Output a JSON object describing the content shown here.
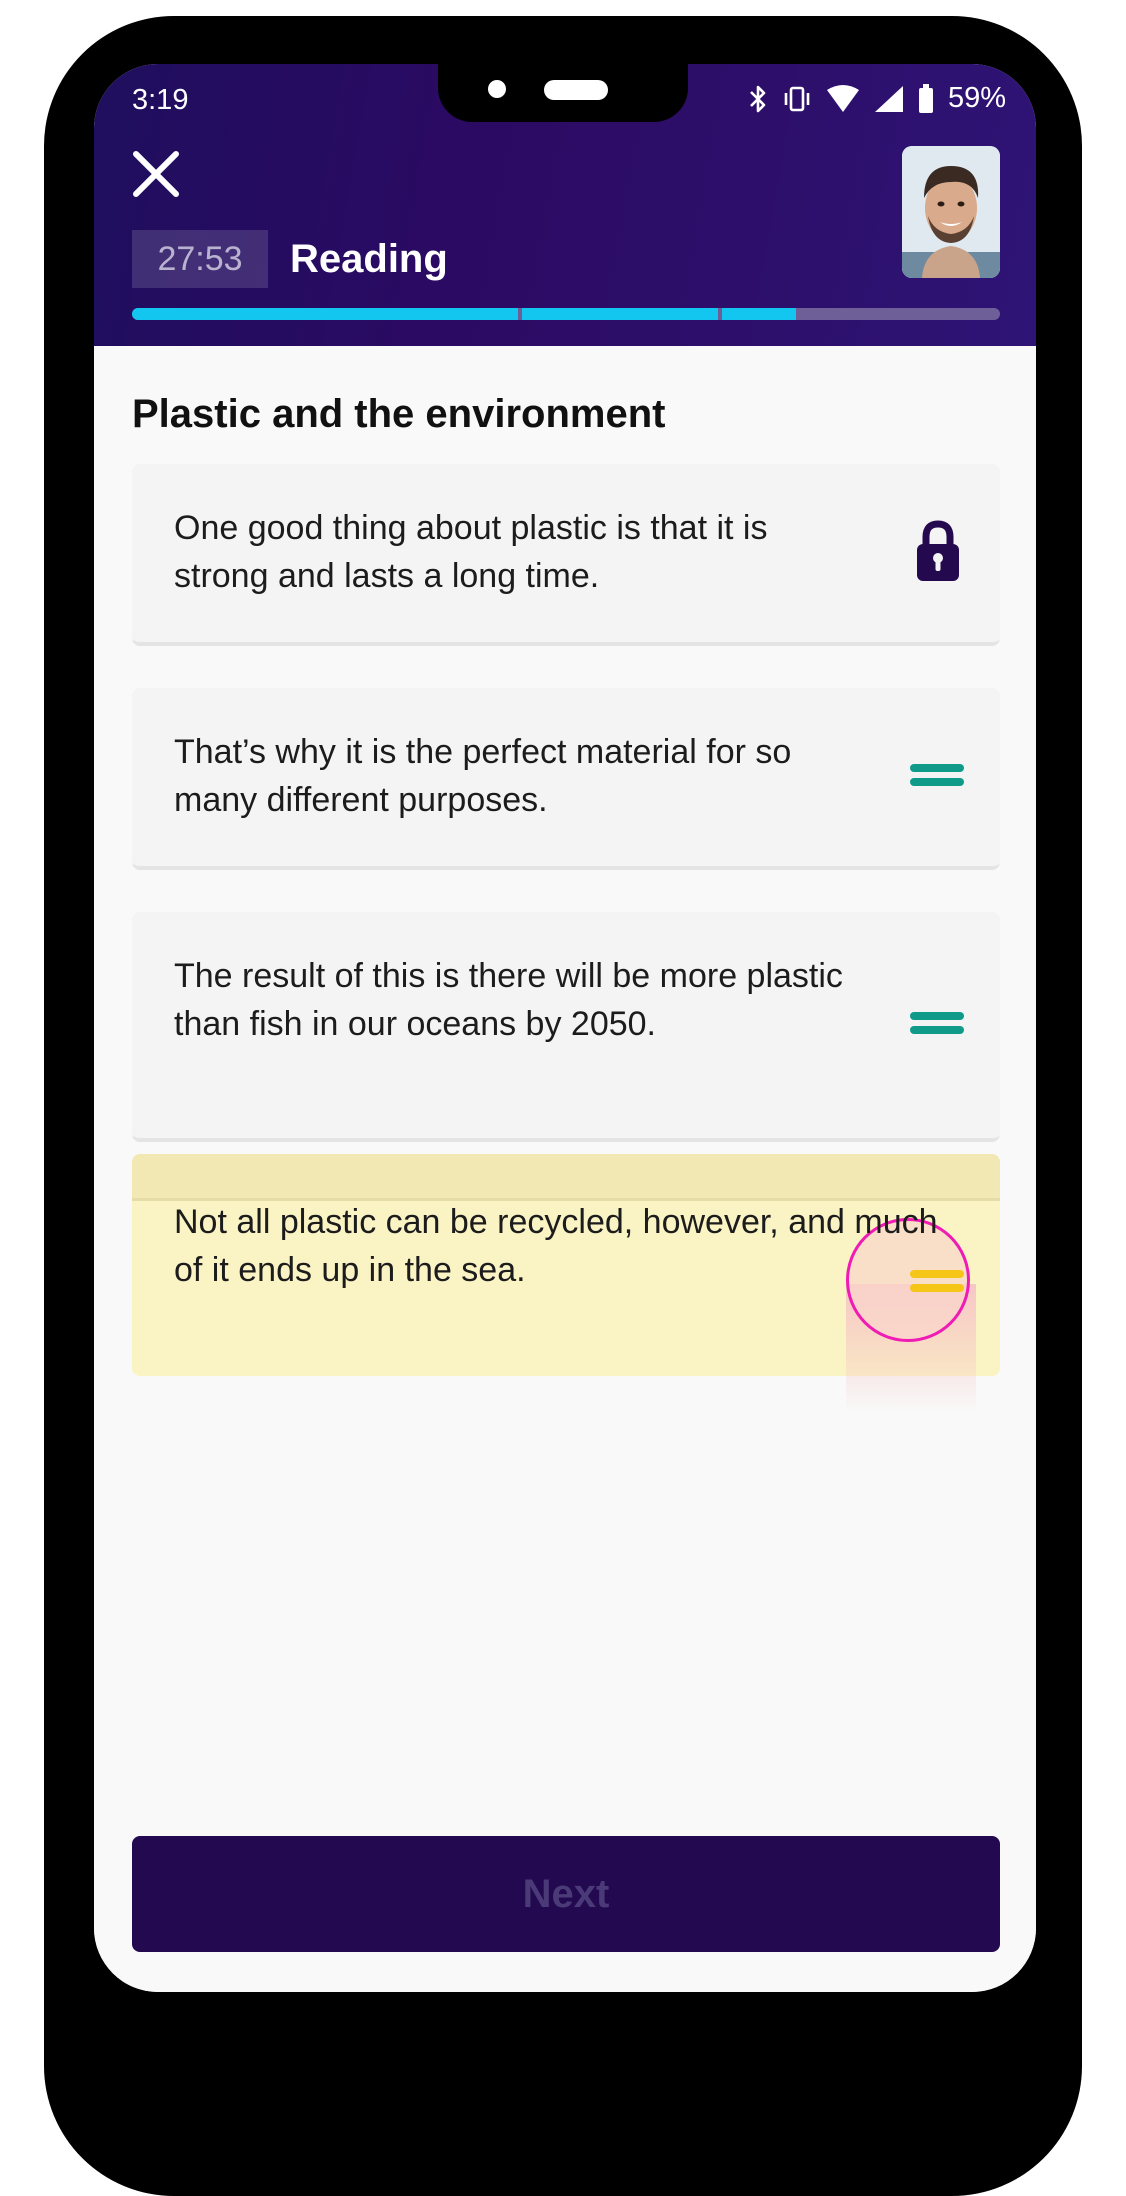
{
  "status_bar": {
    "time": "3:19",
    "battery": "59%"
  },
  "header": {
    "timer": "27:53",
    "section": "Reading"
  },
  "progress": {
    "fill_fraction": 0.845,
    "segments": 3
  },
  "main": {
    "title": "Plastic and the environment",
    "cards": [
      {
        "text": "One good thing about plastic is that it is strong and lasts a long time.",
        "state": "locked"
      },
      {
        "text": "That’s why it is the perfect material for so many different purposes.",
        "state": "draggable"
      },
      {
        "text": "The result of this is there will be more plastic than fish in our oceans by 2050.",
        "state": "draggable"
      },
      {
        "text": "Not all plastic can be recycled, however, and much of it ends up in the sea.",
        "state": "dragging"
      }
    ]
  },
  "footer": {
    "next_label": "Next"
  },
  "colors": {
    "header_bg": "#2b0a63",
    "progress_fill": "#12c6f0",
    "handle_teal": "#0f9a8a",
    "handle_yellow": "#f5c518",
    "lock": "#25094f",
    "drag_highlight": "#faf3c4",
    "touch_ring": "#f01ab4",
    "button_bg": "#23094f"
  }
}
